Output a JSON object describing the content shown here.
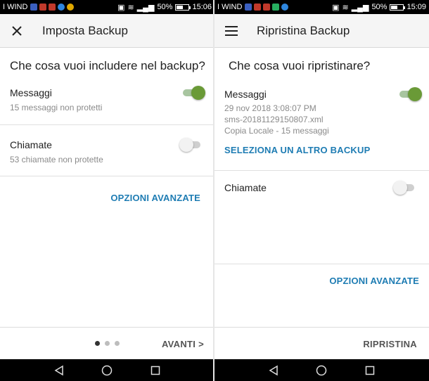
{
  "left": {
    "status": {
      "carrier": "I WIND",
      "battery": "50%",
      "time": "15:06",
      "battery_level": 0.5
    },
    "appbar": {
      "title": "Imposta Backup",
      "nav_icon": "close-icon"
    },
    "question": "Che cosa vuoi includere nel backup?",
    "items": [
      {
        "label": "Messaggi",
        "sub": "15 messaggi non protetti",
        "enabled": true
      },
      {
        "label": "Chiamate",
        "sub": "53 chiamate non protette",
        "enabled": false
      }
    ],
    "advanced_label": "OPZIONI AVANZATE",
    "pager": {
      "pages": 3,
      "current": 1
    },
    "next_label": "AVANTI >"
  },
  "right": {
    "status": {
      "carrier": "I WIND",
      "battery": "50%",
      "time": "15:09",
      "battery_level": 0.5
    },
    "appbar": {
      "title": "Ripristina Backup",
      "nav_icon": "menu-icon"
    },
    "question": "Che cosa vuoi ripristinare?",
    "items": [
      {
        "label": "Messaggi",
        "details": [
          "29 nov 2018 3:08:07 PM",
          "sms-20181129150807.xml",
          "Copia Locale - 15 messaggi"
        ],
        "action_label": "SELEZIONA UN ALTRO BACKUP",
        "enabled": true
      },
      {
        "label": "Chiamate",
        "enabled": false
      }
    ],
    "advanced_label": "OPZIONI AVANZATE",
    "restore_label": "RIPRISTINA"
  },
  "colors": {
    "accent": "#1e7cb3",
    "toggle_on": "#6a9a37",
    "toggle_off": "#cfcfcf"
  },
  "navbar": {
    "icons": [
      "back-icon",
      "home-icon",
      "recents-icon"
    ]
  }
}
